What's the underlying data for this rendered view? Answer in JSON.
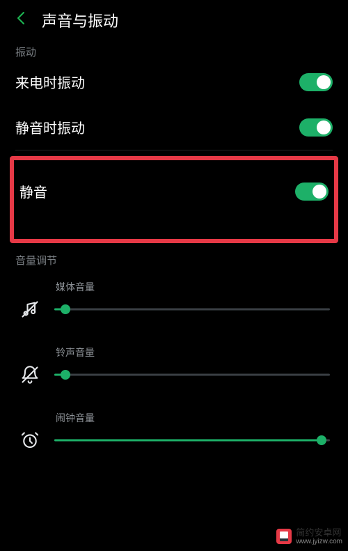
{
  "header": {
    "title": "声音与振动"
  },
  "sections": {
    "vibration": {
      "label": "振动",
      "items": [
        {
          "label": "来电时振动",
          "on": true
        },
        {
          "label": "静音时振动",
          "on": true
        }
      ]
    },
    "mute": {
      "label": "静音",
      "on": true
    },
    "volume": {
      "label": "音量调节",
      "sliders": [
        {
          "label": "媒体音量",
          "value": 4
        },
        {
          "label": "铃声音量",
          "value": 4
        },
        {
          "label": "闹钟音量",
          "value": 97
        }
      ]
    }
  },
  "watermark": {
    "name": "简约安卓网",
    "url": "www.jyizw.com"
  }
}
